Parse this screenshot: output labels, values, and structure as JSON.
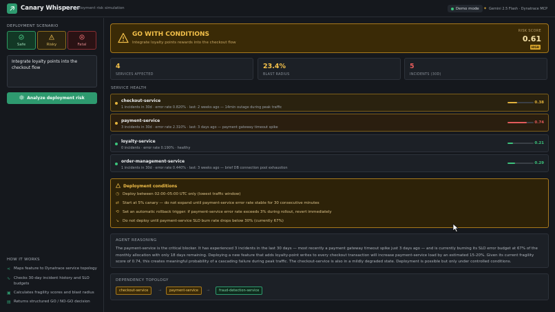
{
  "app": {
    "title": "Canary Whisperer",
    "subtitle": "Pre-deployment risk simulation",
    "demo_label": "Demo mode",
    "model_label": "Gemini 2.5 Flash · Dynatrace MCP"
  },
  "sidebar": {
    "scenario_heading": "DEPLOYMENT SCENARIO",
    "scenarios": [
      {
        "label": "Safe",
        "icon": "check-circle-icon"
      },
      {
        "label": "Risky",
        "icon": "warning-triangle-icon"
      },
      {
        "label": "Fatal",
        "icon": "x-circle-icon"
      }
    ],
    "description": "Integrate loyalty points into the checkout flow",
    "analyze_label": "Analyze deployment risk",
    "how_heading": "HOW IT WORKS",
    "how_items": [
      {
        "text": "Maps feature to Dynatrace service topology",
        "icon": "share-icon"
      },
      {
        "text": "Checks 30-day incident history and SLO budgets",
        "icon": "activity-icon"
      },
      {
        "text": "Calculates fragility scores and blast radius",
        "icon": "calculator-icon"
      },
      {
        "text": "Returns structured GO / NO-GO decision",
        "icon": "clipboard-check-icon"
      }
    ]
  },
  "verdict": {
    "title": "GO WITH CONDITIONS",
    "subtitle": "Integrate loyalty points rewards into the checkout flow",
    "risk_label": "RISK SCORE",
    "risk_score": "0.61",
    "risk_badge": "HIGH",
    "accent": "#f3c04a"
  },
  "metrics": [
    {
      "value": "4",
      "label": "SERVICES AFFECTED",
      "color": "#f3c04a"
    },
    {
      "value": "23.4%",
      "label": "BLAST RADIUS",
      "color": "#f3c04a"
    },
    {
      "value": "5",
      "label": "INCIDENTS (30D)",
      "color": "#e35b5b"
    }
  ],
  "service_health": {
    "heading": "SERVICE HEALTH",
    "services": [
      {
        "name": "checkout-service",
        "detail": "1 incidents in 30d · error rate 0.820% · last: 2 weeks ago — 14min outage during peak traffic",
        "score": "0.38",
        "fraction": 0.38,
        "color": "#e3b33c",
        "status": "warn"
      },
      {
        "name": "payment-service",
        "detail": "3 incidents in 30d · error rate 2.310% · last: 3 days ago — payment gateway timeout spike",
        "score": "0.74",
        "fraction": 0.74,
        "color": "#e35b5b",
        "status": "crit"
      },
      {
        "name": "loyalty-service",
        "detail": "0 incidents · error rate 0.190% · healthy",
        "score": "0.21",
        "fraction": 0.21,
        "color": "#3cc47c",
        "status": "ok"
      },
      {
        "name": "order-management-service",
        "detail": "1 incidents in 30d · error rate 0.440% · last: 3 weeks ago — brief DB connection pool exhaustion",
        "score": "0.29",
        "fraction": 0.29,
        "color": "#3cc47c",
        "status": "ok"
      }
    ]
  },
  "conditions": {
    "title": "Deployment conditions",
    "items": [
      {
        "text": "Deploy between 02:00–05:00 UTC only (lowest traffic window)",
        "icon": "clock-icon"
      },
      {
        "text": "Start at 5% canary — do not expand until payment-service error rate stable for 30 consecutive minutes",
        "icon": "split-icon"
      },
      {
        "text": "Set an automatic rollback trigger: if payment-service error rate exceeds 3% during rollout, revert immediately",
        "icon": "rollback-icon"
      },
      {
        "text": "Do not deploy until payment-service SLO burn rate drops below 30% (currently 67%)",
        "icon": "trend-down-icon"
      }
    ]
  },
  "reasoning": {
    "heading": "AGENT REASONING",
    "text": "The payment-service is the critical blocker. It has experienced 3 incidents in the last 30 days — most recently a payment gateway timeout spike just 3 days ago — and is currently burning its SLO error budget at 67% of the monthly allocation with only 18 days remaining. Deploying a new feature that adds loyalty-point writes to every checkout transaction will increase payment-service load by an estimated 15-20%. Given its current fragility score of 0.74, this creates meaningful probability of a cascading failure during peak traffic. The checkout-service is also in a mildly degraded state. Deployment is possible but only under controlled conditions."
  },
  "topology": {
    "heading": "DEPENDENCY TOPOLOGY",
    "nodes": [
      {
        "label": "checkout-service",
        "tone": "amber"
      },
      {
        "label": "payment-service",
        "tone": "amber"
      },
      {
        "label": "fraud-detection-service",
        "tone": "green"
      }
    ],
    "arrow": "→"
  }
}
